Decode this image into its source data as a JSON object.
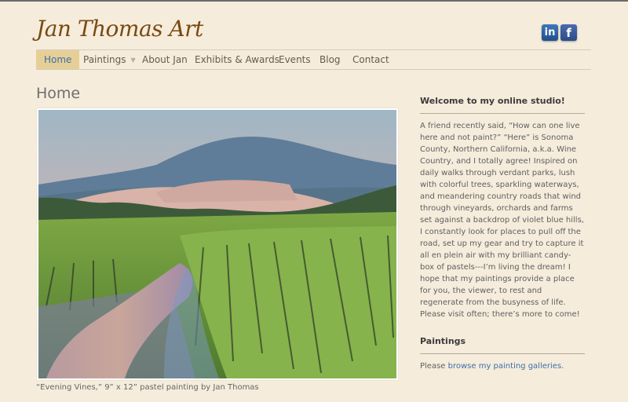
{
  "site": {
    "logo_text": "Jan Thomas Art"
  },
  "social": {
    "linkedin": "in",
    "facebook": "f"
  },
  "nav": {
    "items": [
      {
        "label": "Home"
      },
      {
        "label": "Paintings"
      },
      {
        "label": "About Jan"
      },
      {
        "label": "Exhibits & Awards"
      },
      {
        "label": "Events"
      },
      {
        "label": "Blog"
      },
      {
        "label": "Contact"
      }
    ]
  },
  "main": {
    "title": "Home",
    "caption": "“Evening Vines,” 9” x 12” pastel painting by Jan Thomas"
  },
  "sidebar": {
    "welcome_heading": "Welcome to my online studio!",
    "welcome_text": "A friend recently said, “How can one live here and not paint?” “Here” is Sonoma County, Northern California, a.k.a. Wine Country, and I totally agree! Inspired on daily walks through verdant parks, lush with colorful trees, sparkling waterways, and meandering country roads that wind through vineyards, orchards and farms set against a backdrop of violet blue hills, I constantly look for places to pull off the road, set up my gear and try to capture it all en plein air with my brilliant candy-box of pastels---I’m living the dream! I hope that my paintings provide a place for you, the viewer, to rest and regenerate from the busyness of life. Please visit often; there’s more to come!",
    "paintings_heading": "Paintings",
    "paintings_prefix": "Please ",
    "paintings_link": "browse my painting galleries",
    "paintings_suffix": "."
  },
  "colors": {
    "background": "#f5ecdc",
    "nav_active_bg": "#e6cf97",
    "link": "#3e6fa6",
    "logo": "#7a4a12"
  }
}
